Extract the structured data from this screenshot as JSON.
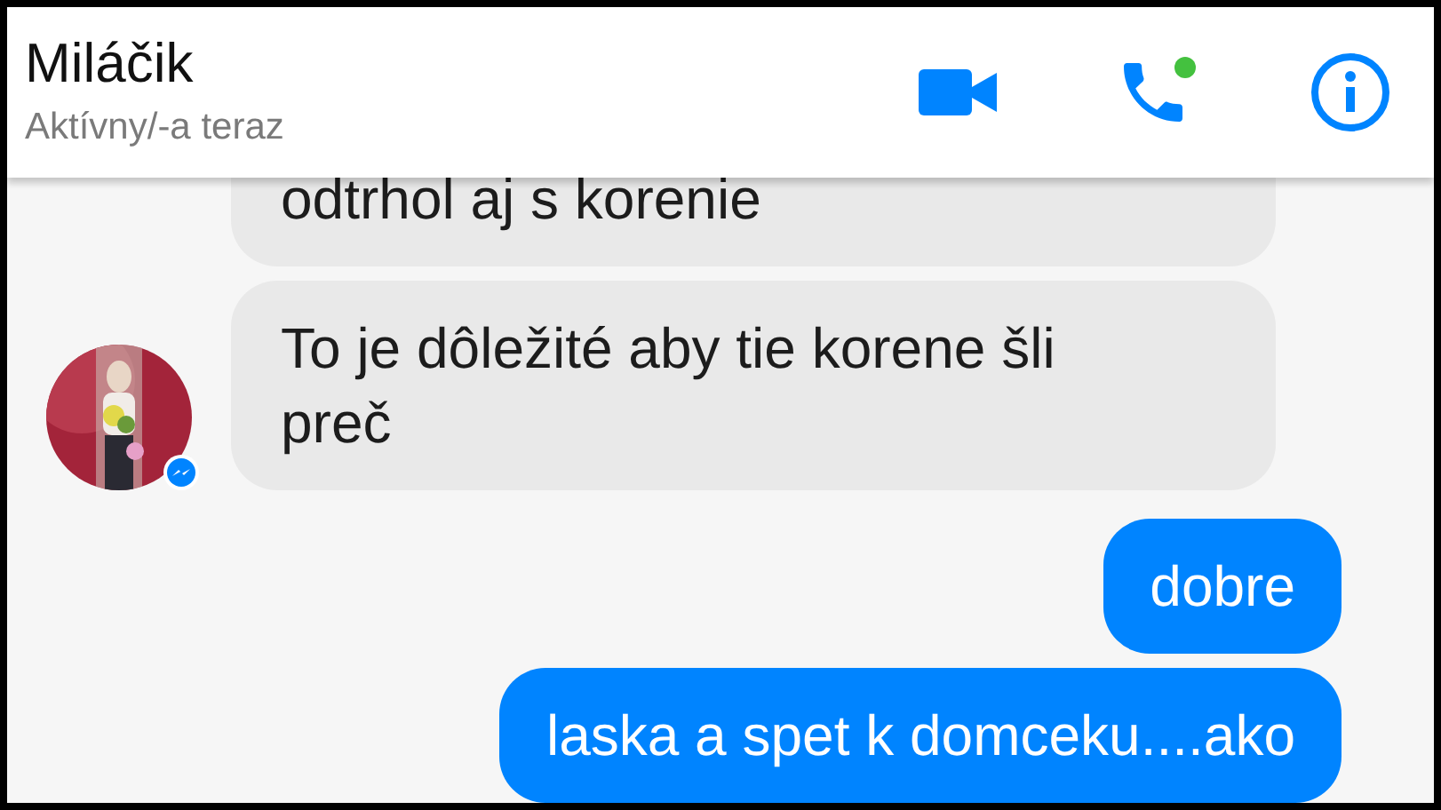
{
  "header": {
    "name": "Miláčik",
    "status": "Aktívny/-a teraz",
    "online": true
  },
  "messages": [
    {
      "kind": "incoming",
      "text": "odtrhol aj s korenie",
      "avatar": false
    },
    {
      "kind": "incoming",
      "text": "To je dôležité aby tie korene šli preč",
      "avatar": true
    },
    {
      "kind": "outgoing",
      "text": "dobre"
    },
    {
      "kind": "outgoing",
      "text": "laska a spet k domceku....ako"
    }
  ]
}
